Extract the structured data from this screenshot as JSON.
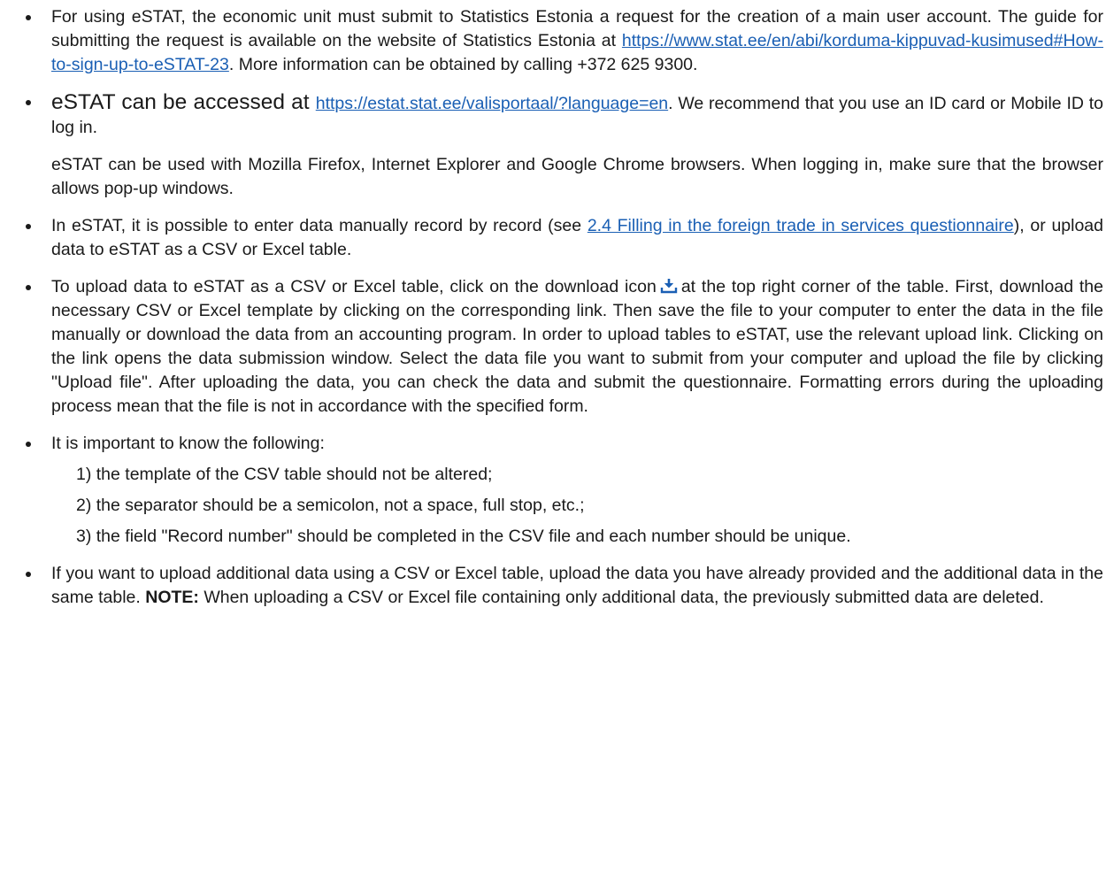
{
  "items": [
    {
      "t1": "For using eSTAT, the economic unit must submit to Statistics Estonia a request for the creation of a main user account. The guide for submitting the request is available on the website of Statistics Estonia at ",
      "link": "https://www.stat.ee/en/abi/korduma-kippuvad-kusimused#How-to-sign-up-to-eSTAT-23",
      "t2": ". More information can be obtained by calling +372 625 9300."
    },
    {
      "t1": "eSTAT can be accessed at ",
      "link": "https://estat.stat.ee/valisportaal/?language=en",
      "t2": ". We recommend that you use an ID card or Mobile ID to log in.",
      "sub": "eSTAT can be used with Mozilla Firefox, Internet Explorer and Google Chrome browsers. When logging in, make sure that the browser allows pop-up windows."
    },
    {
      "t1": "In eSTAT, it is possible to enter data manually record by record (see ",
      "link": "2.4 Filling in the foreign trade in services questionnaire",
      "t2": "), or upload data to eSTAT as a CSV or Excel table."
    },
    {
      "t1": "To upload data to eSTAT as a CSV or Excel table, click on the download icon",
      "icon": "download-icon",
      "t2": "at the top right corner of the table. First, download the necessary CSV or Excel template by clicking on the corresponding link. Then save the file to your computer to enter the data in the file manually or download the data from an accounting program. In order to upload tables to eSTAT, use the relevant upload link. Clicking on the link opens the data submission window. Select the data file you want to submit from your computer and upload the file by clicking \"Upload file\". After uploading the data, you can check the data and submit the questionnaire. Formatting errors during the uploading process mean that the file is not in accordance with the specified form."
    },
    {
      "t1": "It is important to know the following:",
      "numbered": [
        "1) the template of the CSV table should not be altered;",
        "2) the separator should be a semicolon, not a space, full stop, etc.;",
        "3) the field \"Record number\" should be completed in the CSV file and each number should be unique."
      ]
    },
    {
      "t1": "If you want to upload additional data using a CSV or Excel table, upload the data you have already provided and the additional data in the same table. ",
      "note": "NOTE:",
      "t2": " When uploading a CSV or Excel file containing only additional data, the previously submitted data are deleted."
    }
  ],
  "colors": {
    "text": "#1a1a1a",
    "link": "#1a5fb4"
  }
}
